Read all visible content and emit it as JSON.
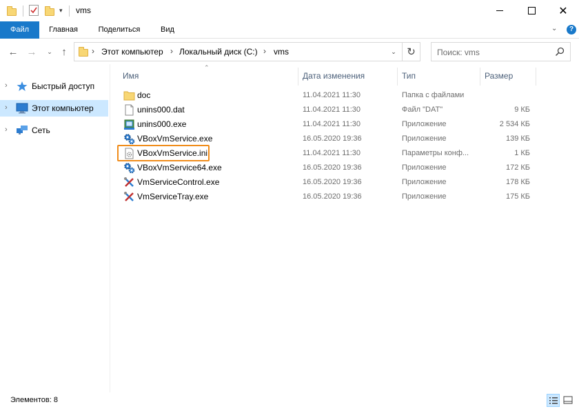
{
  "window": {
    "title": "vms"
  },
  "ribbon": {
    "tabs": [
      "Файл",
      "Главная",
      "Поделиться",
      "Вид"
    ],
    "help_label": "?"
  },
  "address": {
    "crumbs": [
      "Этот компьютер",
      "Локальный диск (C:)",
      "vms"
    ]
  },
  "search": {
    "placeholder": "Поиск: vms"
  },
  "navpane": {
    "items": [
      {
        "label": "Быстрый доступ",
        "icon": "star-icon",
        "selected": false
      },
      {
        "label": "Этот компьютер",
        "icon": "computer-icon",
        "selected": true
      },
      {
        "label": "Сеть",
        "icon": "network-icon",
        "selected": false
      }
    ]
  },
  "filelist": {
    "columns": [
      "Имя",
      "Дата изменения",
      "Тип",
      "Размер"
    ],
    "rows": [
      {
        "name": "doc",
        "date": "11.04.2021 11:30",
        "type": "Папка с файлами",
        "size": "",
        "icon": "folder-icon"
      },
      {
        "name": "unins000.dat",
        "date": "11.04.2021 11:30",
        "type": "Файл \"DAT\"",
        "size": "9 КБ",
        "icon": "document-icon"
      },
      {
        "name": "unins000.exe",
        "date": "11.04.2021 11:30",
        "type": "Приложение",
        "size": "2 534 КБ",
        "icon": "installer-icon"
      },
      {
        "name": "VBoxVmService.exe",
        "date": "16.05.2020 19:36",
        "type": "Приложение",
        "size": "139 КБ",
        "icon": "service-gear-icon"
      },
      {
        "name": "VBoxVmService.ini",
        "date": "11.04.2021 11:30",
        "type": "Параметры конф...",
        "size": "1 КБ",
        "icon": "settings-file-icon",
        "highlighted": true
      },
      {
        "name": "VBoxVmService64.exe",
        "date": "16.05.2020 19:36",
        "type": "Приложение",
        "size": "172 КБ",
        "icon": "service-gear-icon"
      },
      {
        "name": "VmServiceControl.exe",
        "date": "16.05.2020 19:36",
        "type": "Приложение",
        "size": "178 КБ",
        "icon": "tools-icon"
      },
      {
        "name": "VmServiceTray.exe",
        "date": "16.05.2020 19:36",
        "type": "Приложение",
        "size": "175 КБ",
        "icon": "tools-icon"
      }
    ]
  },
  "status": {
    "count_text": "Элементов: 8"
  },
  "colors": {
    "accent": "#1979ca",
    "selection": "#cce8ff",
    "highlight": "#f08c1a"
  }
}
